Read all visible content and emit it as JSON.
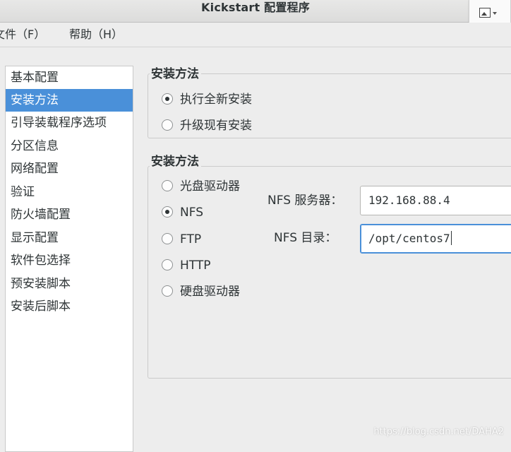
{
  "window": {
    "title": "Kickstart 配置程序",
    "title_tool_icon": "image-icon"
  },
  "menubar": {
    "items": [
      "文件（F）",
      "帮助（H）"
    ]
  },
  "sidebar": {
    "selected_index": 1,
    "items": [
      "基本配置",
      "安装方法",
      "引导装载程序选项",
      "分区信息",
      "网络配置",
      "验证",
      "防火墙配置",
      "显示配置",
      "软件包选择",
      "预安装脚本",
      "安装后脚本"
    ]
  },
  "install_type": {
    "legend": "安装方法",
    "options": [
      {
        "label": "执行全新安装",
        "checked": true
      },
      {
        "label": "升级现有安装",
        "checked": false
      }
    ]
  },
  "install_source": {
    "legend": "安装方法",
    "options": [
      {
        "label": "光盘驱动器",
        "checked": false
      },
      {
        "label": "NFS",
        "checked": true
      },
      {
        "label": "FTP",
        "checked": false
      },
      {
        "label": "HTTP",
        "checked": false
      },
      {
        "label": "硬盘驱动器",
        "checked": false
      }
    ],
    "nfs_server_label": "NFS 服务器：",
    "nfs_server_value": "192.168.88.4",
    "nfs_dir_label": "NFS 目录：",
    "nfs_dir_value": "/opt/centos7"
  },
  "watermark": "https://blog.csdn.net/DAHA2",
  "colors": {
    "selection": "#4a90d9",
    "window_bg": "#ededed"
  }
}
